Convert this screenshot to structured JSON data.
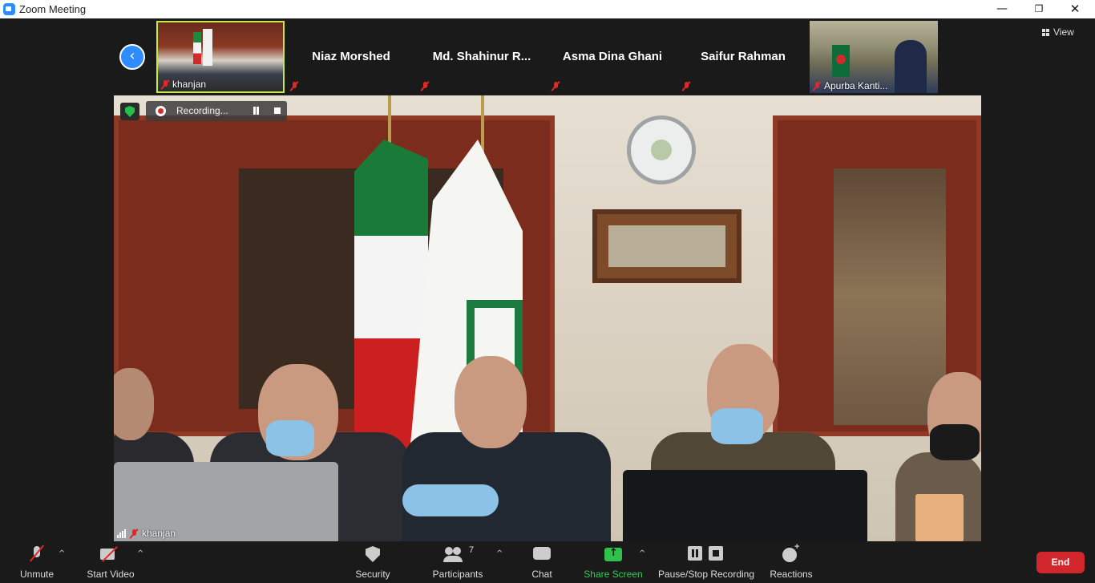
{
  "window": {
    "title": "Zoom Meeting",
    "minimize_glyph": "—",
    "maximize_glyph": "❐",
    "close_glyph": "✕"
  },
  "gallery": {
    "prev_glyph": "‹",
    "tiles": [
      {
        "name": "khanjan",
        "type": "video",
        "muted": true,
        "active": true
      },
      {
        "name": "Niaz Morshed",
        "type": "name",
        "muted": true
      },
      {
        "name": "Md.  Shahinur  R...",
        "type": "name",
        "muted": true
      },
      {
        "name": "Asma Dina Ghani",
        "type": "name",
        "muted": true
      },
      {
        "name": "Saifur Rahman",
        "type": "name",
        "muted": true
      },
      {
        "name": "Apurba Kanti...",
        "type": "video",
        "muted": true
      }
    ]
  },
  "view_button": {
    "label": "View",
    "icon": "grid-icon"
  },
  "recording": {
    "label": "Recording...",
    "pause_icon": "pause-icon",
    "stop_icon": "stop-icon"
  },
  "main_video": {
    "speaker": "khanjan",
    "muted": true
  },
  "toolbar": {
    "unmute": "Unmute",
    "start_video": "Start Video",
    "security": "Security",
    "participants": "Participants",
    "participants_count": "7",
    "chat": "Chat",
    "share_screen": "Share Screen",
    "recording": "Pause/Stop Recording",
    "reactions": "Reactions",
    "end": "End",
    "caret_glyph": "^"
  },
  "colors": {
    "accent": "#2d8cff",
    "share_green": "#33cc55",
    "end_red": "#d0262c",
    "active_speaker": "#c6e84b",
    "muted_red": "#e02828"
  }
}
